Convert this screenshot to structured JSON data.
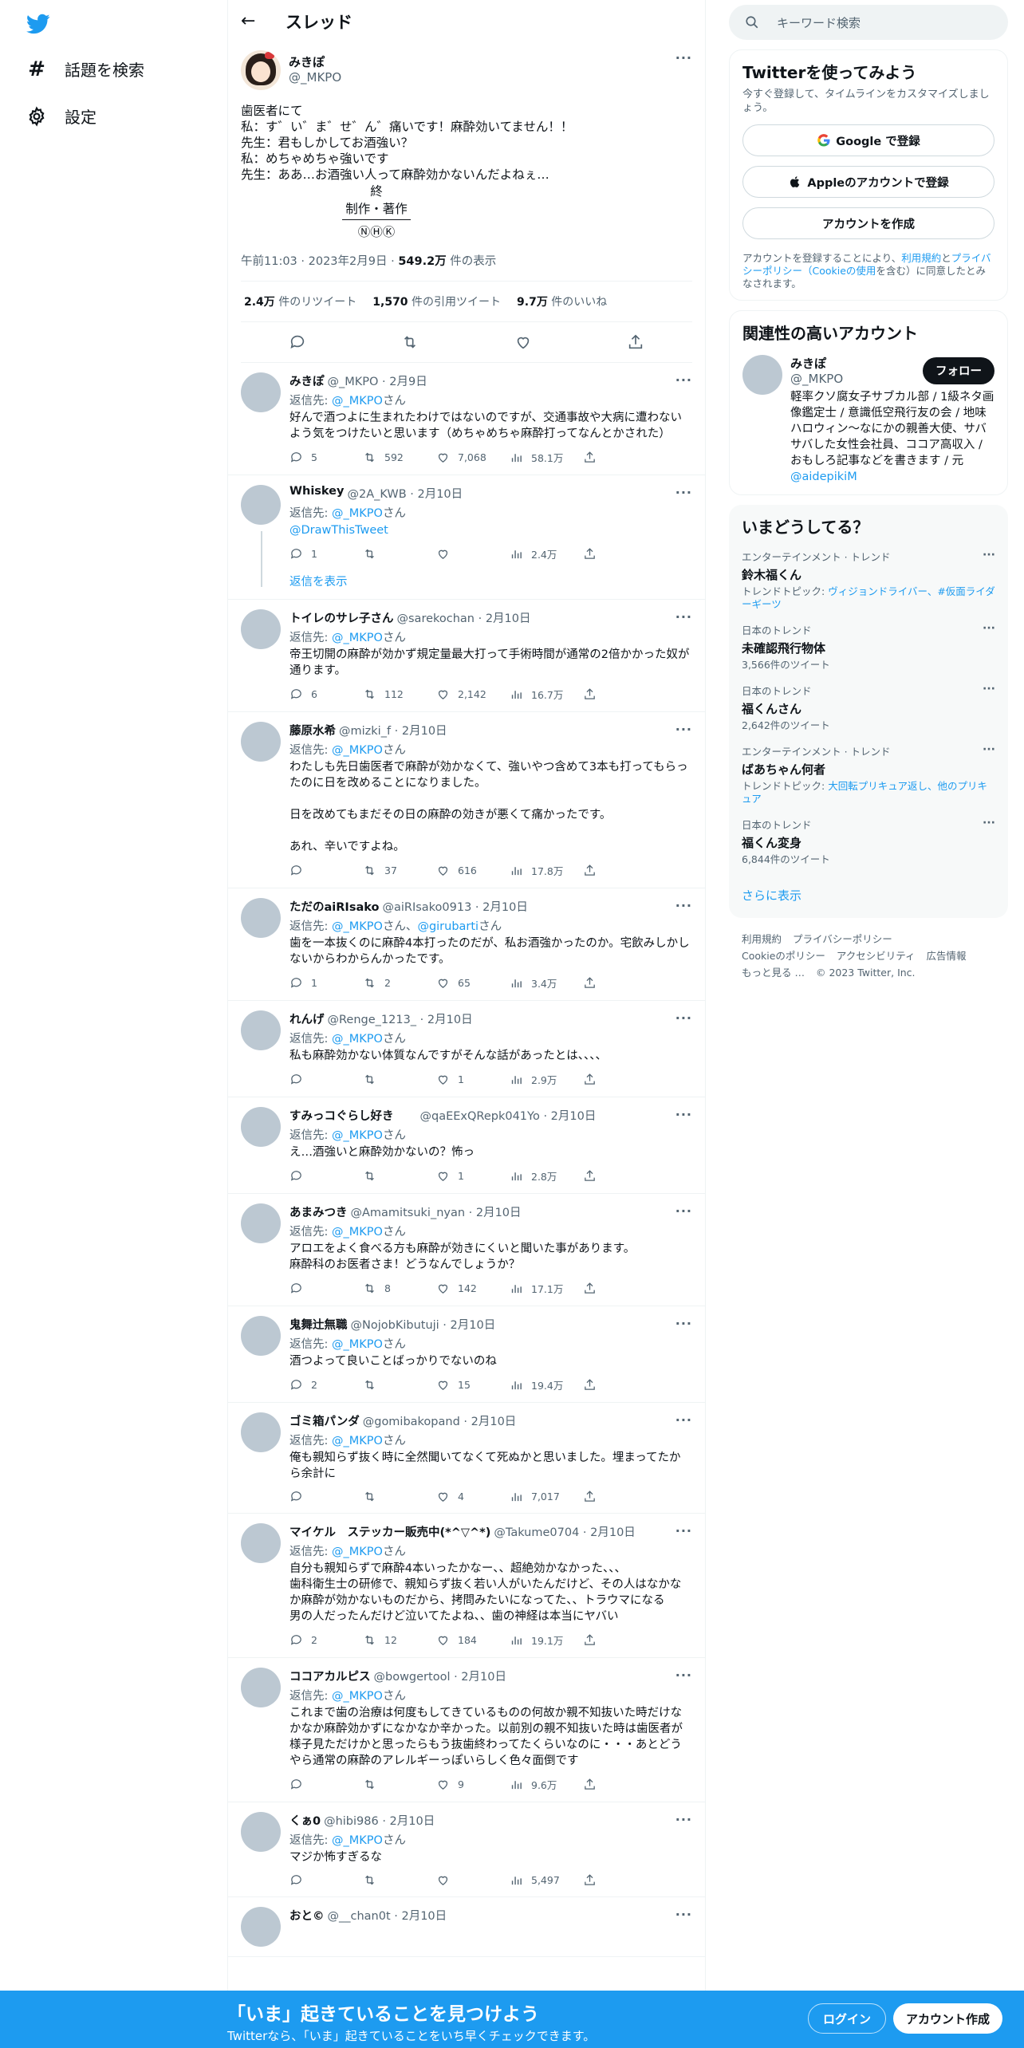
{
  "nav": {
    "explore_label": "話題を検索",
    "settings_label": "設定"
  },
  "main_header": {
    "title": "スレッド"
  },
  "original_tweet": {
    "name": "みきぽ",
    "handle": "@_MKPO",
    "more": "···",
    "body_lines": [
      "歯医者にて",
      "私：す゛い゛ま゛せ゛ん゛痛いです！麻酔効いてません！！",
      "先生：君もしかしてお酒強い？",
      "私：めちゃめちゃ強いです",
      "先生：ああ…お酒強い人って麻酔効かないんだよねぇ…"
    ],
    "credits": [
      "終",
      "制作・著作",
      "ⓃⒽⓀ"
    ],
    "time": "午前11:03",
    "date": "2023年2月9日",
    "views": "549.2万",
    "views_suffix": "件の表示",
    "retweets": "2.4万",
    "retweets_label": "件のリツイート",
    "quotes": "1,570",
    "quotes_label": "件の引用ツイート",
    "likes": "9.7万",
    "likes_label": "件のいいね"
  },
  "replies": [
    {
      "name": "みきぽ",
      "meta": "@_MKPO · 2月9日",
      "reply_to": "_MKPO",
      "reply_to_extra": "",
      "text": "好んで酒つよに生まれたわけではないのですが、交通事故や大病に遭わないよう気をつけたいと思います（めちゃめちゃ麻酔打ってなんとかされた）",
      "extra_link": "",
      "show_replies": "",
      "replies": "5",
      "rts": "592",
      "likes": "7,068",
      "views": "58.1万"
    },
    {
      "name": "Whiskey",
      "meta": "@2A_KWB · 2月10日",
      "reply_to": "_MKPO",
      "reply_to_extra": "",
      "text": "",
      "extra_link": "@DrawThisTweet",
      "show_replies": "返信を表示",
      "replies": "1",
      "rts": "",
      "likes": "",
      "views": "2.4万"
    },
    {
      "name": "トイレのサレ子さん",
      "meta": "@sarekochan · 2月10日",
      "reply_to": "_MKPO",
      "reply_to_extra": "",
      "text": "帝王切開の麻酔が効かず規定量最大打って手術時間が通常の2倍かかった奴が通ります。",
      "extra_link": "",
      "show_replies": "",
      "replies": "6",
      "rts": "112",
      "likes": "2,142",
      "views": "16.7万"
    },
    {
      "name": "藤原水希",
      "meta": "@mizki_f · 2月10日",
      "reply_to": "_MKPO",
      "reply_to_extra": "",
      "text": "わたしも先日歯医者で麻酔が効かなくて、強いやつ含めて3本も打ってもらったのに日を改めることになりました。\n\n日を改めてもまだその日の麻酔の効きが悪くて痛かったです。\n\nあれ、辛いですよね。",
      "extra_link": "",
      "show_replies": "",
      "replies": "",
      "rts": "37",
      "likes": "616",
      "views": "17.8万"
    },
    {
      "name": "ただのaiRIsako",
      "meta": "@aiRIsako0913 · 2月10日",
      "reply_to": "_MKPO",
      "reply_to_extra": "@girubarti",
      "text": "歯を一本抜くのに麻酔4本打ったのだが、私お酒強かったのか。宅飲みしかしないからわからんかったです。",
      "extra_link": "",
      "show_replies": "",
      "replies": "1",
      "rts": "2",
      "likes": "65",
      "views": "3.4万"
    },
    {
      "name": "れんげ",
      "meta": "@Renge_1213_ · 2月10日",
      "reply_to": "_MKPO",
      "reply_to_extra": "",
      "text": "私も麻酔効かない体質なんですがそんな話があったとは、、、、",
      "extra_link": "",
      "show_replies": "",
      "replies": "",
      "rts": "",
      "likes": "1",
      "views": "2.9万"
    },
    {
      "name": "すみっコぐらし好き",
      "meta": "　　@qaEExQRepk041Yo · 2月10日",
      "reply_to": "_MKPO",
      "reply_to_extra": "",
      "text": "え…酒強いと麻酔効かないの？怖っ",
      "extra_link": "",
      "show_replies": "",
      "replies": "",
      "rts": "",
      "likes": "1",
      "views": "2.8万"
    },
    {
      "name": "あまみつき",
      "meta": "@Amamitsuki_nyan · 2月10日",
      "reply_to": "_MKPO",
      "reply_to_extra": "",
      "text": "アロエをよく食べる方も麻酔が効きにくいと聞いた事があります。\n麻酔科のお医者さま！どうなんでしょうか？",
      "extra_link": "",
      "show_replies": "",
      "replies": "",
      "rts": "8",
      "likes": "142",
      "views": "17.1万"
    },
    {
      "name": "鬼舞辻無職",
      "meta": "@NojobKibutuji · 2月10日",
      "reply_to": "_MKPO",
      "reply_to_extra": "",
      "text": "酒つよって良いことばっかりでないのね",
      "extra_link": "",
      "show_replies": "",
      "replies": "2",
      "rts": "",
      "likes": "15",
      "views": "19.4万"
    },
    {
      "name": "ゴミ箱パンダ",
      "meta": "@gomibakopand · 2月10日",
      "reply_to": "_MKPO",
      "reply_to_extra": "",
      "text": "俺も親知らず抜く時に全然聞いてなくて死ぬかと思いました。埋まってたから余計に",
      "extra_link": "",
      "show_replies": "",
      "replies": "",
      "rts": "",
      "likes": "4",
      "views": "7,017"
    },
    {
      "name": "マイケル　ステッカー販売中(*^▽^*)",
      "meta": "@Takume0704 · 2月10日",
      "reply_to": "_MKPO",
      "reply_to_extra": "",
      "text": "自分も親知らずで麻酔4本いったかなー、、超絶効かなかった、、、\n歯科衛生士の研修で、親知らず抜く若い人がいたんだけど、その人はなかなか麻酔が効かないものだから、拷問みたいになってた、、トラウマになる\n男の人だったんだけど泣いてたよね、、歯の神経は本当にヤバい",
      "extra_link": "",
      "show_replies": "",
      "replies": "2",
      "rts": "12",
      "likes": "184",
      "views": "19.1万"
    },
    {
      "name": "ココアカルピス",
      "meta": "@bowgertool · 2月10日",
      "reply_to": "_MKPO",
      "reply_to_extra": "",
      "text": "これまで歯の治療は何度もしてきているものの何故か親不知抜いた時だけなかなか麻酔効かずになかなか辛かった。以前別の親不知抜いた時は歯医者が様子見ただけかと思ったらもう抜歯終わってたくらいなのに・・・あとどうやら通常の麻酔のアレルギーっぽいらしく色々面倒です",
      "extra_link": "",
      "show_replies": "",
      "replies": "",
      "rts": "",
      "likes": "9",
      "views": "9.6万"
    },
    {
      "name": "くぁ0",
      "meta": "@hibi986 · 2月10日",
      "reply_to": "_MKPO",
      "reply_to_extra": "",
      "text": "マジか怖すぎるな",
      "extra_link": "",
      "show_replies": "",
      "replies": "",
      "rts": "",
      "likes": "",
      "views": "5,497"
    },
    {
      "name": "おと©",
      "meta": "@__chan0t · 2月10日",
      "reply_to": "",
      "reply_to_extra": "",
      "text": "",
      "extra_link": "",
      "show_replies": "",
      "replies": "",
      "rts": "",
      "likes": "",
      "views": ""
    }
  ],
  "reply_labels": {
    "prefix": "返信先: ",
    "at": "@",
    "suffix": "さん",
    "joiner": "さん、"
  },
  "search": {
    "placeholder": "キーワード検索"
  },
  "signup_card": {
    "title": "Twitterを使ってみよう",
    "subtitle": "今すぐ登録して、タイムラインをカスタマイズしましょう。",
    "google": "Google で登録",
    "apple": "Appleのアカウントで登録",
    "create": "アカウントを作成",
    "legal_1": "アカウントを登録することにより、",
    "legal_terms": "利用規約",
    "legal_2": "と",
    "legal_privacy": "プライバシーポリシー（Cookieの使用",
    "legal_3": "を含む）に同意したとみなされます。"
  },
  "related": {
    "title": "関連性の高いアカウント",
    "name": "みきぽ",
    "handle": "@_MKPO",
    "follow": "フォロー",
    "bio": "軽率クソ腐女子サブカル部 / 1級ネタ画像鑑定士 / 意識低空飛行友の会 / 地味ハロウィン〜なにかの親善大使、サバサバした女性会社員、ココア高収入 / おもしろ記事などを書きます / 元",
    "bio_link": "@aidepikiM"
  },
  "trends": {
    "title": "いまどうしてる？",
    "items": [
      {
        "cat": "エンターテインメント · トレンド",
        "name": "鈴木福くん",
        "sub_prefix": "トレンドトピック: ",
        "sub_links": "ヴィジョンドライバー、#仮面ライダーギーツ",
        "count": ""
      },
      {
        "cat": "日本のトレンド",
        "name": "未確認飛行物体",
        "sub_prefix": "",
        "sub_links": "",
        "count": "3,566件のツイート"
      },
      {
        "cat": "日本のトレンド",
        "name": "福くんさん",
        "sub_prefix": "",
        "sub_links": "",
        "count": "2,642件のツイート"
      },
      {
        "cat": "エンターテインメント · トレンド",
        "name": "ばあちゃん何者",
        "sub_prefix": "トレンドトピック: ",
        "sub_links": "大回転プリキュア返し、他のプリキュア",
        "count": ""
      },
      {
        "cat": "日本のトレンド",
        "name": "福くん変身",
        "sub_prefix": "",
        "sub_links": "",
        "count": "6,844件のツイート"
      }
    ],
    "more": "···",
    "show_more": "さらに表示"
  },
  "footer": {
    "terms": "利用規約",
    "privacy": "プライバシーポリシー",
    "cookie": "Cookieのポリシー",
    "access": "アクセシビリティ",
    "ads": "広告情報",
    "more": "もっと見る …",
    "copyright": "© 2023 Twitter, Inc."
  },
  "bottom_bar": {
    "title": "「いま」起きていることを見つけよう",
    "subtitle": "Twitterなら、「いま」起きていることをいち早くチェックできます。",
    "login": "ログイン",
    "signup": "アカウント作成"
  },
  "colors": {
    "accent": "#1d9bf0",
    "text": "#0f1419",
    "muted": "#536471"
  }
}
